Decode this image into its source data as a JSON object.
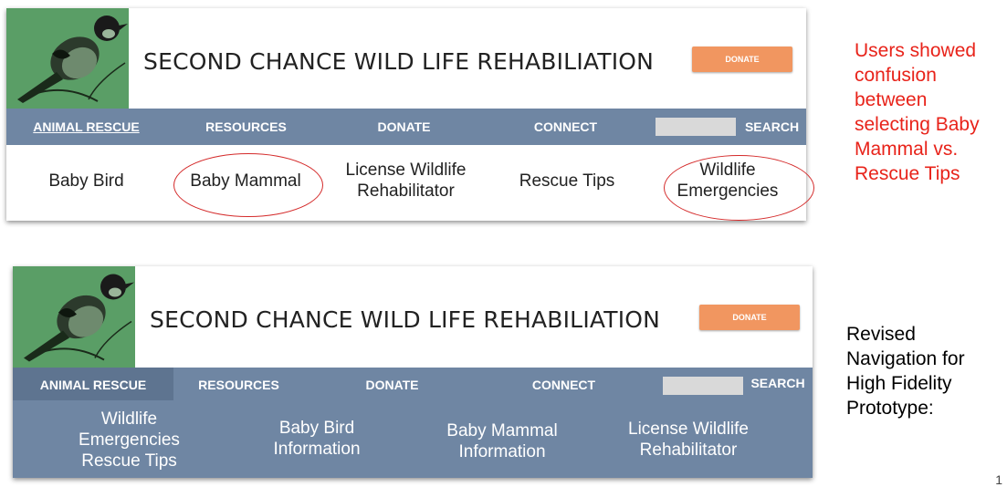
{
  "before": {
    "site_title": "SECOND CHANCE WILD LIFE REHABILIATION",
    "donate_button": "DONATE",
    "nav": [
      "ANIMAL RESCUE",
      "RESOURCES",
      "DONATE",
      "CONNECT"
    ],
    "search_label": "SEARCH",
    "submenu": [
      "Baby Bird",
      "Baby Mammal",
      "License Wildlife Rehabilitator",
      "Rescue Tips",
      "Wildlife Emergencies"
    ]
  },
  "after": {
    "site_title": "SECOND CHANCE WILD LIFE REHABILIATION",
    "donate_button": "DONATE",
    "nav": [
      "ANIMAL RESCUE",
      "RESOURCES",
      "DONATE",
      "CONNECT"
    ],
    "search_label": "SEARCH",
    "submenu": [
      "Wildlife Emergencies Rescue Tips",
      "Baby Bird Information",
      "Baby Mammal Information",
      "License Wildlife Rehabilitator"
    ]
  },
  "notes": {
    "confusion": "Users showed confusion between selecting Baby Mammal vs. Rescue Tips",
    "revised": "Revised Navigation for High Fidelity Prototype:"
  },
  "page_number": "1",
  "colors": {
    "nav_bar": "#6f86a3",
    "nav_active": "#5e7490",
    "donate_button": "#f19660",
    "logo_background": "#5a9e66",
    "annotation_red": "#e8231a"
  }
}
